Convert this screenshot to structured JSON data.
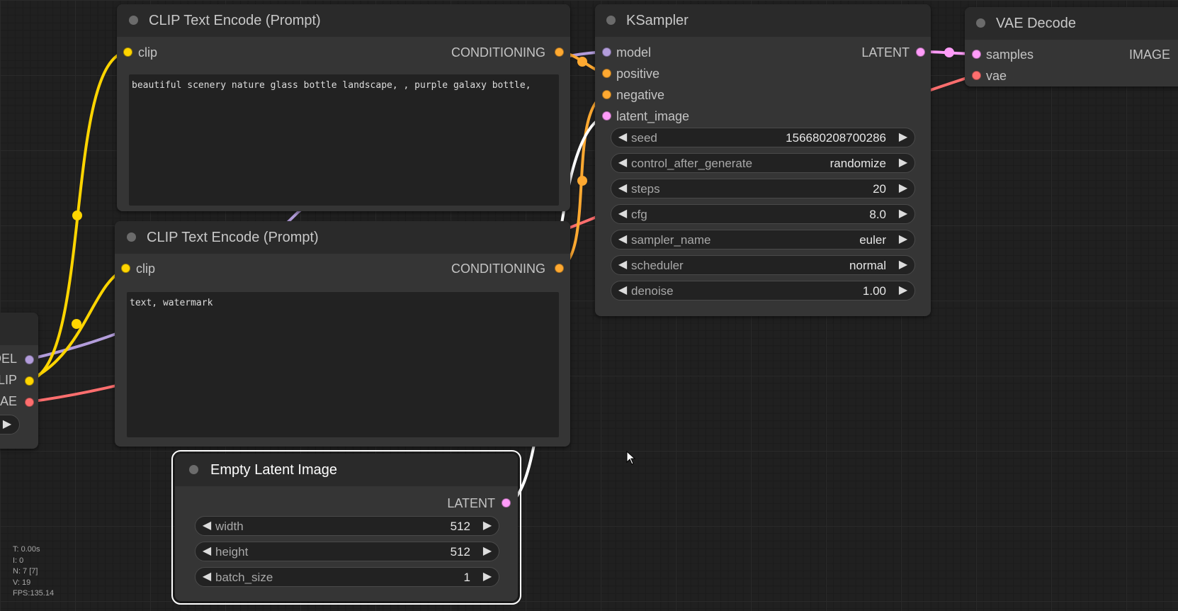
{
  "colors": {
    "clip": "#ffd500",
    "conditioning": "#ffa931",
    "model": "#b39ddb",
    "latent": "#ff9cf9",
    "vae": "#ff6e6e",
    "wire_latent": "#ffffff"
  },
  "nodes": {
    "clip_pos": {
      "title": "CLIP Text Encode (Prompt)",
      "input": "clip",
      "output": "CONDITIONING",
      "text": "beautiful scenery nature glass bottle landscape, , purple galaxy bottle,"
    },
    "clip_neg": {
      "title": "CLIP Text Encode (Prompt)",
      "input": "clip",
      "output": "CONDITIONING",
      "text": "text, watermark"
    },
    "ksampler": {
      "title": "KSampler",
      "inputs": [
        "model",
        "positive",
        "negative",
        "latent_image"
      ],
      "output": "LATENT",
      "widgets": [
        {
          "name": "seed",
          "value": "156680208700286"
        },
        {
          "name": "control_after_generate",
          "value": "randomize"
        },
        {
          "name": "steps",
          "value": "20"
        },
        {
          "name": "cfg",
          "value": "8.0"
        },
        {
          "name": "sampler_name",
          "value": "euler"
        },
        {
          "name": "scheduler",
          "value": "normal"
        },
        {
          "name": "denoise",
          "value": "1.00"
        }
      ]
    },
    "vae_decode": {
      "title": "VAE Decode",
      "inputs": [
        "samples",
        "vae"
      ],
      "output": "IMAGE"
    },
    "empty_latent": {
      "title": "Empty Latent Image",
      "output": "LATENT",
      "widgets": [
        {
          "name": "width",
          "value": "512"
        },
        {
          "name": "height",
          "value": "512"
        },
        {
          "name": "batch_size",
          "value": "1"
        }
      ]
    },
    "checkpoint": {
      "outputs": [
        "DEL",
        "LIP",
        "AE"
      ]
    }
  },
  "stats": {
    "t": "T: 0.00s",
    "i": "I: 0",
    "n": "N: 7 [7]",
    "v": "V: 19",
    "fps": "FPS:135.14"
  }
}
